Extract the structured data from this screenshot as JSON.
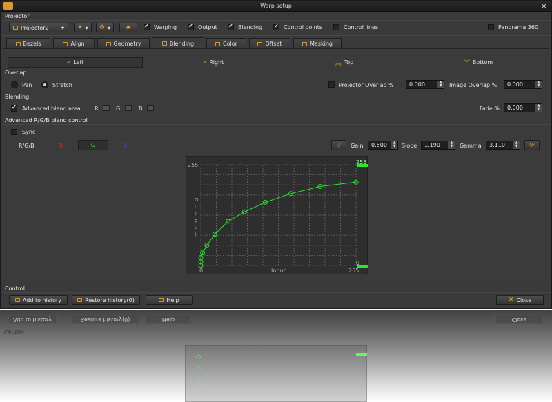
{
  "window": {
    "title": "Warp setup"
  },
  "sections": {
    "projector": "Projector",
    "overlap": "Overlap",
    "blending": "Blending",
    "advanced": "Advanced R/G/B blend control",
    "control": "Control"
  },
  "toolbar": {
    "projector_select": "Projector2",
    "checks": [
      {
        "label": "Warping",
        "checked": true
      },
      {
        "label": "Output",
        "checked": true
      },
      {
        "label": "Blending",
        "checked": true
      },
      {
        "label": "Control points",
        "checked": true
      },
      {
        "label": "Control lines",
        "checked": false
      }
    ],
    "panorama": {
      "label": "Panorama 360",
      "checked": false
    }
  },
  "tabs": [
    "Bezels",
    "Align",
    "Geometry",
    "Blending",
    "Color",
    "Offset",
    "Masking"
  ],
  "active_tab": "Blending",
  "sides": [
    "Left",
    "Right",
    "Top",
    "Bottom"
  ],
  "overlap": {
    "pan": "Pan",
    "stretch": "Stretch",
    "projector_overlap_label": "Projector Overlap %",
    "projector_overlap_value": "0.000",
    "image_overlap_label": "Image Overlap %",
    "image_overlap_value": "0.000"
  },
  "blending": {
    "advanced_label": "Advanced blend area",
    "r": "R",
    "g": "G",
    "b": "B",
    "fade_label": "Fade %",
    "fade_value": "0.000"
  },
  "advanced": {
    "sync": "Sync",
    "rgb_label": "R/G/B",
    "channel_r": "R",
    "channel_g": "G",
    "channel_b": "B",
    "gain_label": "Gain",
    "gain_value": "0.500",
    "slope_label": "Slope",
    "slope_value": "1.190",
    "gamma_label": "Gamma",
    "gamma_value": "3.110"
  },
  "graph": {
    "ymax_label": "255",
    "ymin_label": "0",
    "xmin_label": "0",
    "xmax_label": "255",
    "xlabel": "Input",
    "ylabel": "Output",
    "right_top": "255",
    "right_bottom": "0",
    "curve_color": "#29e629"
  },
  "chart_data": {
    "type": "line",
    "xlabel": "Input",
    "ylabel": "Output",
    "xlim": [
      0,
      255
    ],
    "ylim": [
      0,
      255
    ],
    "x": [
      0,
      0,
      0,
      3,
      10,
      23,
      45,
      72,
      106,
      148,
      196,
      255
    ],
    "y": [
      0,
      10,
      20,
      32,
      51,
      79,
      112,
      136,
      160,
      182,
      200,
      211
    ]
  },
  "footer": {
    "add_history": "Add to history",
    "restore_history": "Restore history(0)",
    "help": "Help",
    "close": "Close"
  },
  "colors": {
    "accent": "#e19a2a",
    "background": "#3a3a3a",
    "green": "#29e629",
    "red": "#d22",
    "blue": "#2a4bd8"
  }
}
